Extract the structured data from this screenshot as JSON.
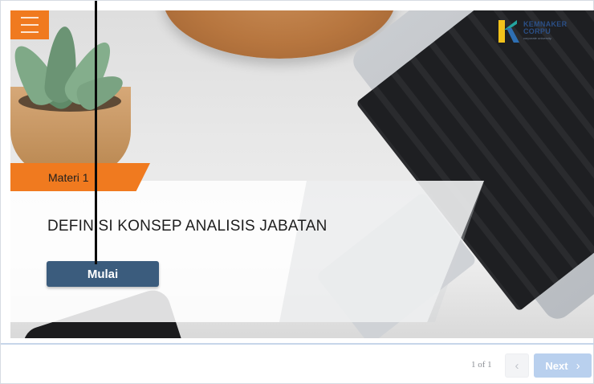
{
  "slide": {
    "materi_label": "Materi 1",
    "title": "DEFINISI KONSEP ANALISIS JABATAN",
    "start_button": "Mulai"
  },
  "logo": {
    "line1": "KEMNAKER",
    "line2": "CORPU",
    "tagline": "corporate university"
  },
  "footer": {
    "page_counter": "1 of 1",
    "prev_icon": "chevron-left",
    "next_label": "Next",
    "next_icon": "chevron-right"
  },
  "colors": {
    "accent_orange": "#f07a1f",
    "button_blue": "#3b5c7d",
    "next_button": "#b9d0ee"
  }
}
